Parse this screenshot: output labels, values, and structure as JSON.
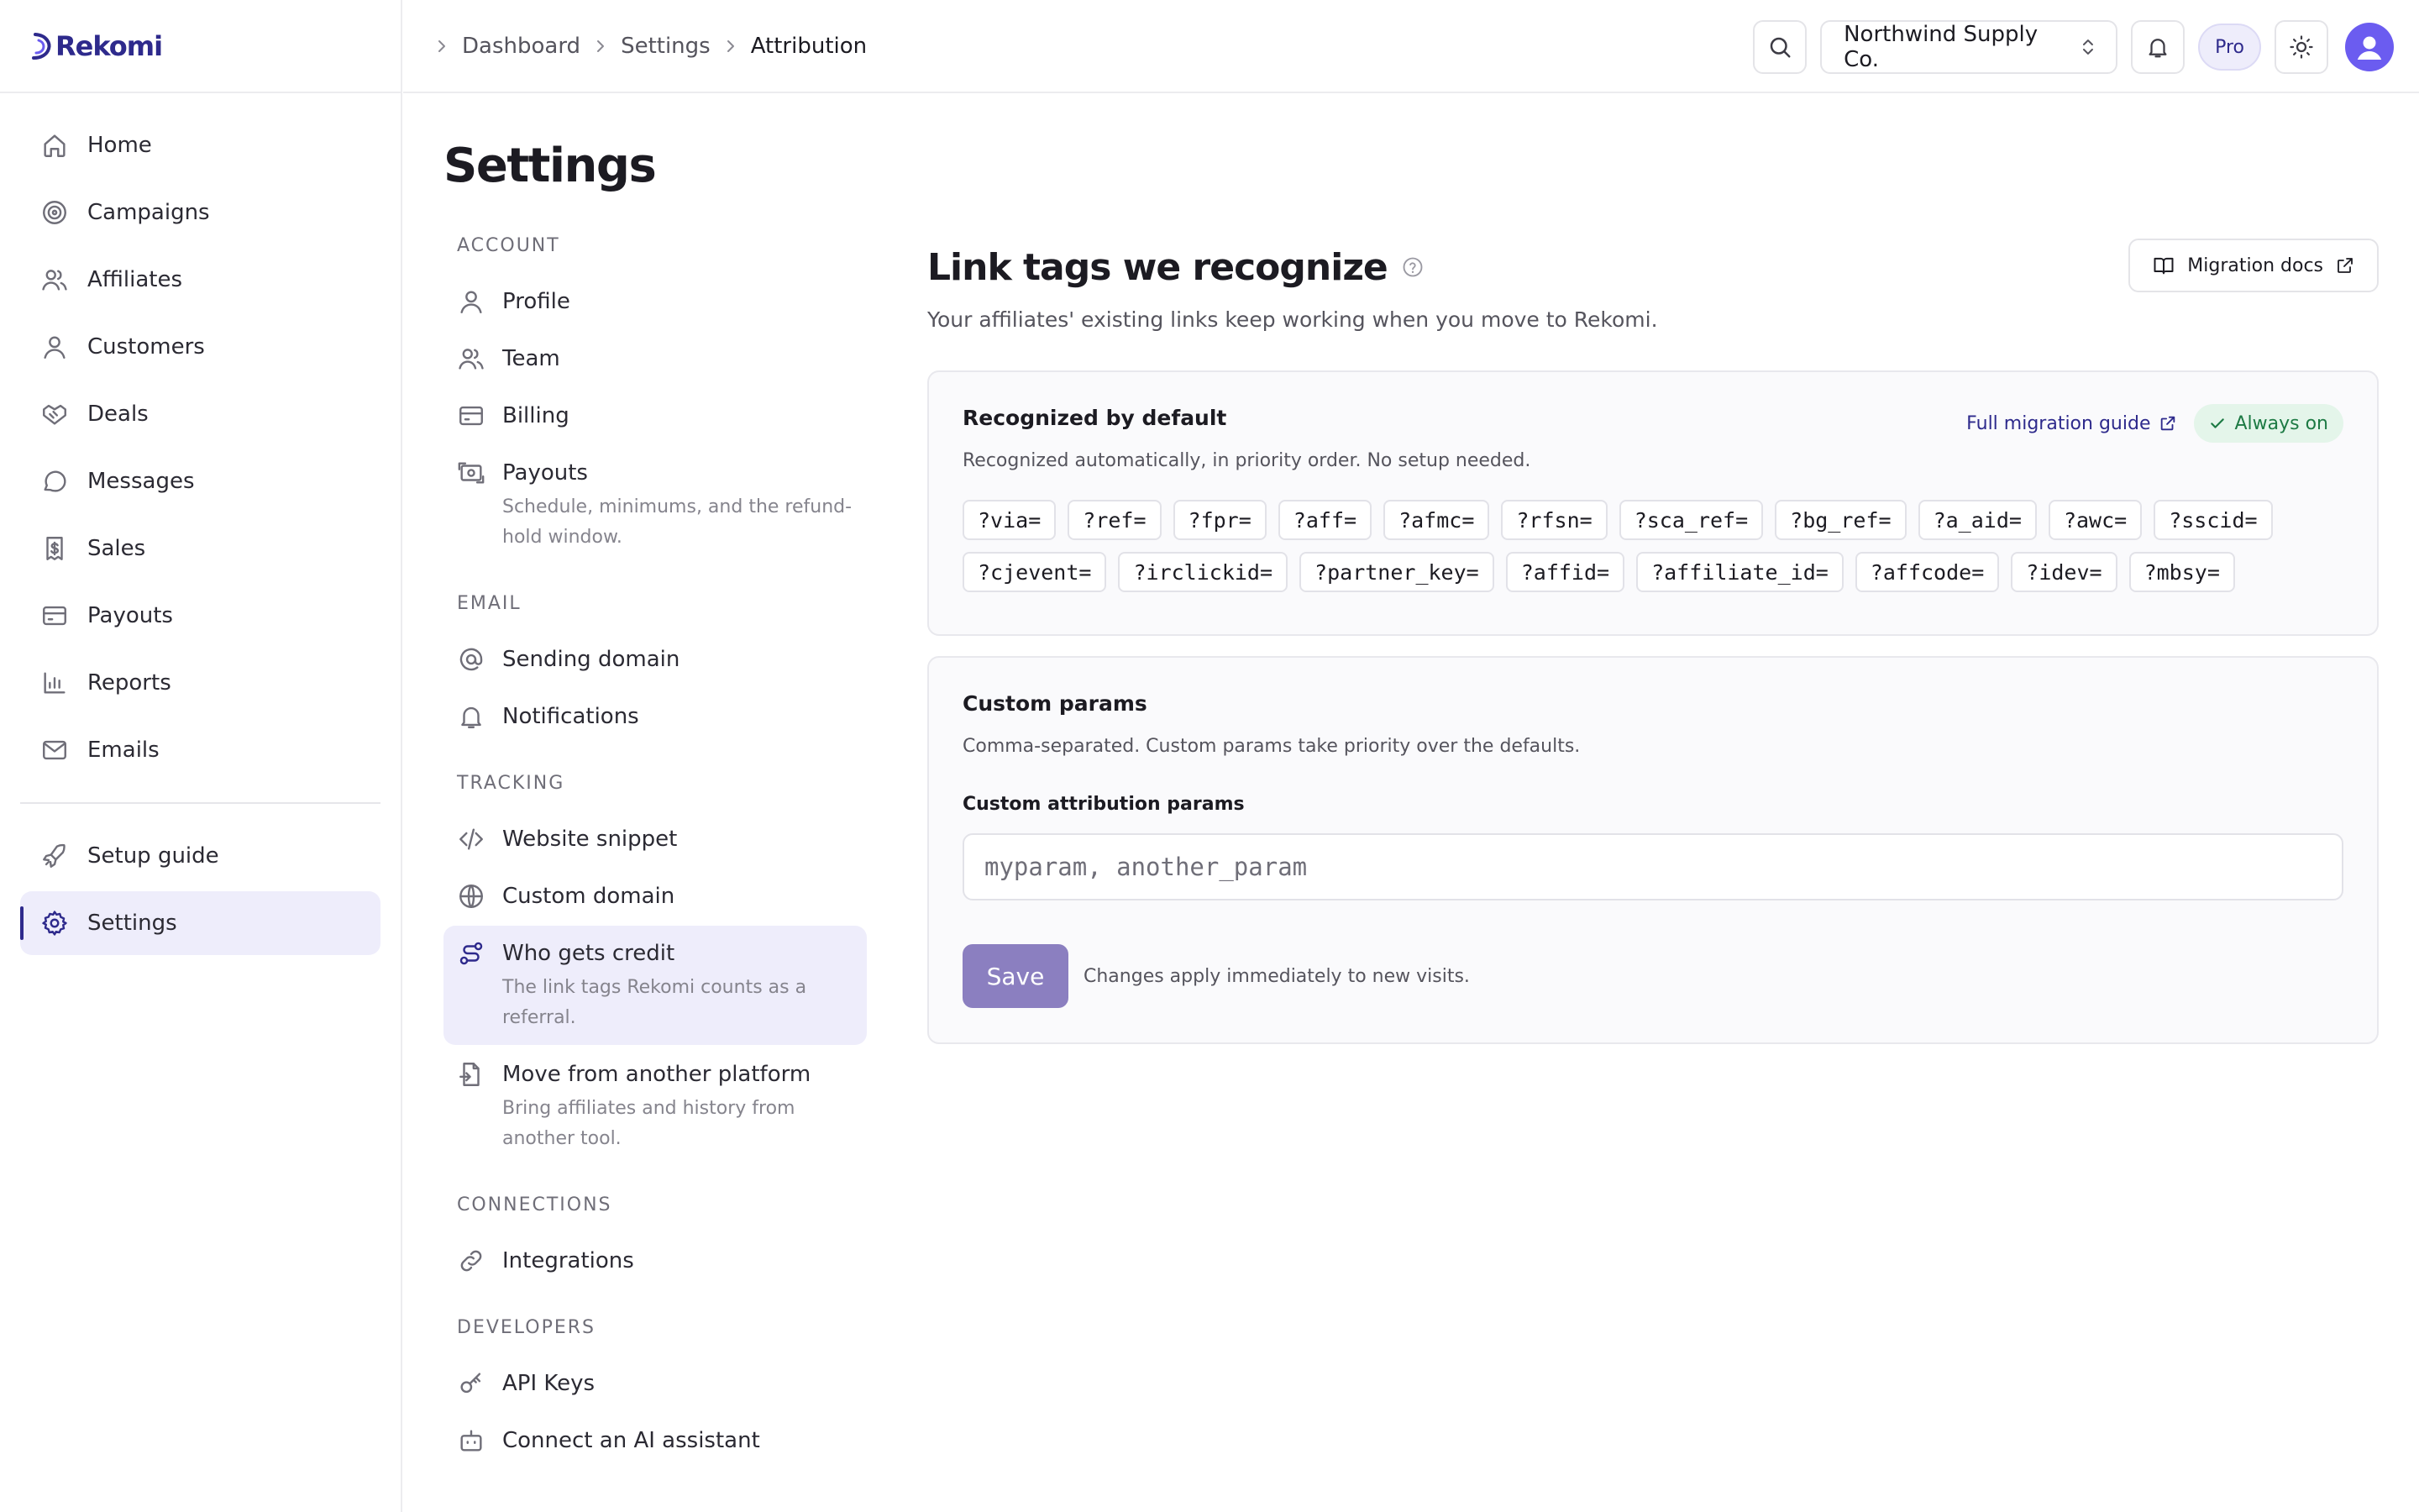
{
  "brand": {
    "name": "Rekomi"
  },
  "app_nav": [
    {
      "key": "home",
      "label": "Home",
      "icon": "home-icon"
    },
    {
      "key": "campaigns",
      "label": "Campaigns",
      "icon": "target-icon"
    },
    {
      "key": "affiliates",
      "label": "Affiliates",
      "icon": "users-icon"
    },
    {
      "key": "customers",
      "label": "Customers",
      "icon": "user-icon"
    },
    {
      "key": "deals",
      "label": "Deals",
      "icon": "handshake-icon"
    },
    {
      "key": "messages",
      "label": "Messages",
      "icon": "chat-icon"
    },
    {
      "key": "sales",
      "label": "Sales",
      "icon": "receipt-icon"
    },
    {
      "key": "payouts",
      "label": "Payouts",
      "icon": "card-icon"
    },
    {
      "key": "reports",
      "label": "Reports",
      "icon": "bar-chart-icon"
    },
    {
      "key": "emails",
      "label": "Emails",
      "icon": "mail-icon"
    }
  ],
  "app_nav_bottom": [
    {
      "key": "setup-guide",
      "label": "Setup guide",
      "icon": "rocket-icon"
    },
    {
      "key": "settings",
      "label": "Settings",
      "icon": "gear-icon",
      "active": true
    }
  ],
  "breadcrumb": [
    "Dashboard",
    "Settings",
    "Attribution"
  ],
  "topbar": {
    "org_name": "Northwind Supply Co.",
    "plan_badge": "Pro"
  },
  "page_title": "Settings",
  "settings_nav": {
    "groups": [
      {
        "label": "ACCOUNT",
        "items": [
          {
            "label": "Profile",
            "icon": "user-icon"
          },
          {
            "label": "Team",
            "icon": "users-icon"
          },
          {
            "label": "Billing",
            "icon": "card-icon"
          },
          {
            "label": "Payouts",
            "icon": "cash-icon",
            "desc": "Schedule, minimums, and the refund-hold window."
          }
        ]
      },
      {
        "label": "EMAIL",
        "items": [
          {
            "label": "Sending domain",
            "icon": "at-icon"
          },
          {
            "label": "Notifications",
            "icon": "bell-icon"
          }
        ]
      },
      {
        "label": "TRACKING",
        "items": [
          {
            "label": "Website snippet",
            "icon": "code-icon"
          },
          {
            "label": "Custom domain",
            "icon": "globe-icon"
          },
          {
            "label": "Who gets credit",
            "icon": "route-icon",
            "desc": "The link tags Rekomi counts as a referral.",
            "active": true
          },
          {
            "label": "Move from another platform",
            "icon": "file-import-icon",
            "desc": "Bring affiliates and history from another tool."
          }
        ]
      },
      {
        "label": "CONNECTIONS",
        "items": [
          {
            "label": "Integrations",
            "icon": "link-icon"
          }
        ]
      },
      {
        "label": "DEVELOPERS",
        "items": [
          {
            "label": "API Keys",
            "icon": "key-icon"
          },
          {
            "label": "Connect an AI assistant",
            "icon": "bot-icon"
          }
        ]
      }
    ]
  },
  "section": {
    "title": "Link tags we recognize",
    "subtitle": "Your affiliates' existing links keep working when you move to Rekomi.",
    "migration_docs_label": "Migration docs"
  },
  "defaults_card": {
    "title": "Recognized by default",
    "subtitle": "Recognized automatically, in priority order. No setup needed.",
    "guide_link": "Full migration guide",
    "status_badge": "Always on",
    "params": [
      "?via=",
      "?ref=",
      "?fpr=",
      "?aff=",
      "?afmc=",
      "?rfsn=",
      "?sca_ref=",
      "?bg_ref=",
      "?a_aid=",
      "?awc=",
      "?sscid=",
      "?cjevent=",
      "?irclickid=",
      "?partner_key=",
      "?affid=",
      "?affiliate_id=",
      "?affcode=",
      "?idev=",
      "?mbsy="
    ]
  },
  "custom_card": {
    "title": "Custom params",
    "subtitle": "Comma-separated. Custom params take priority over the defaults.",
    "field_label": "Custom attribution params",
    "field_value": "",
    "field_placeholder": "myparam, another_param",
    "save_label": "Save",
    "save_note": "Changes apply immediately to new visits."
  },
  "colors": {
    "accent": "#2e2a8c",
    "active_bg": "#eeedfb",
    "save_button": "#8b7fc0",
    "success_bg": "#e4f5ea",
    "success_text": "#1d7a44",
    "avatar": "#6b5cf0"
  }
}
